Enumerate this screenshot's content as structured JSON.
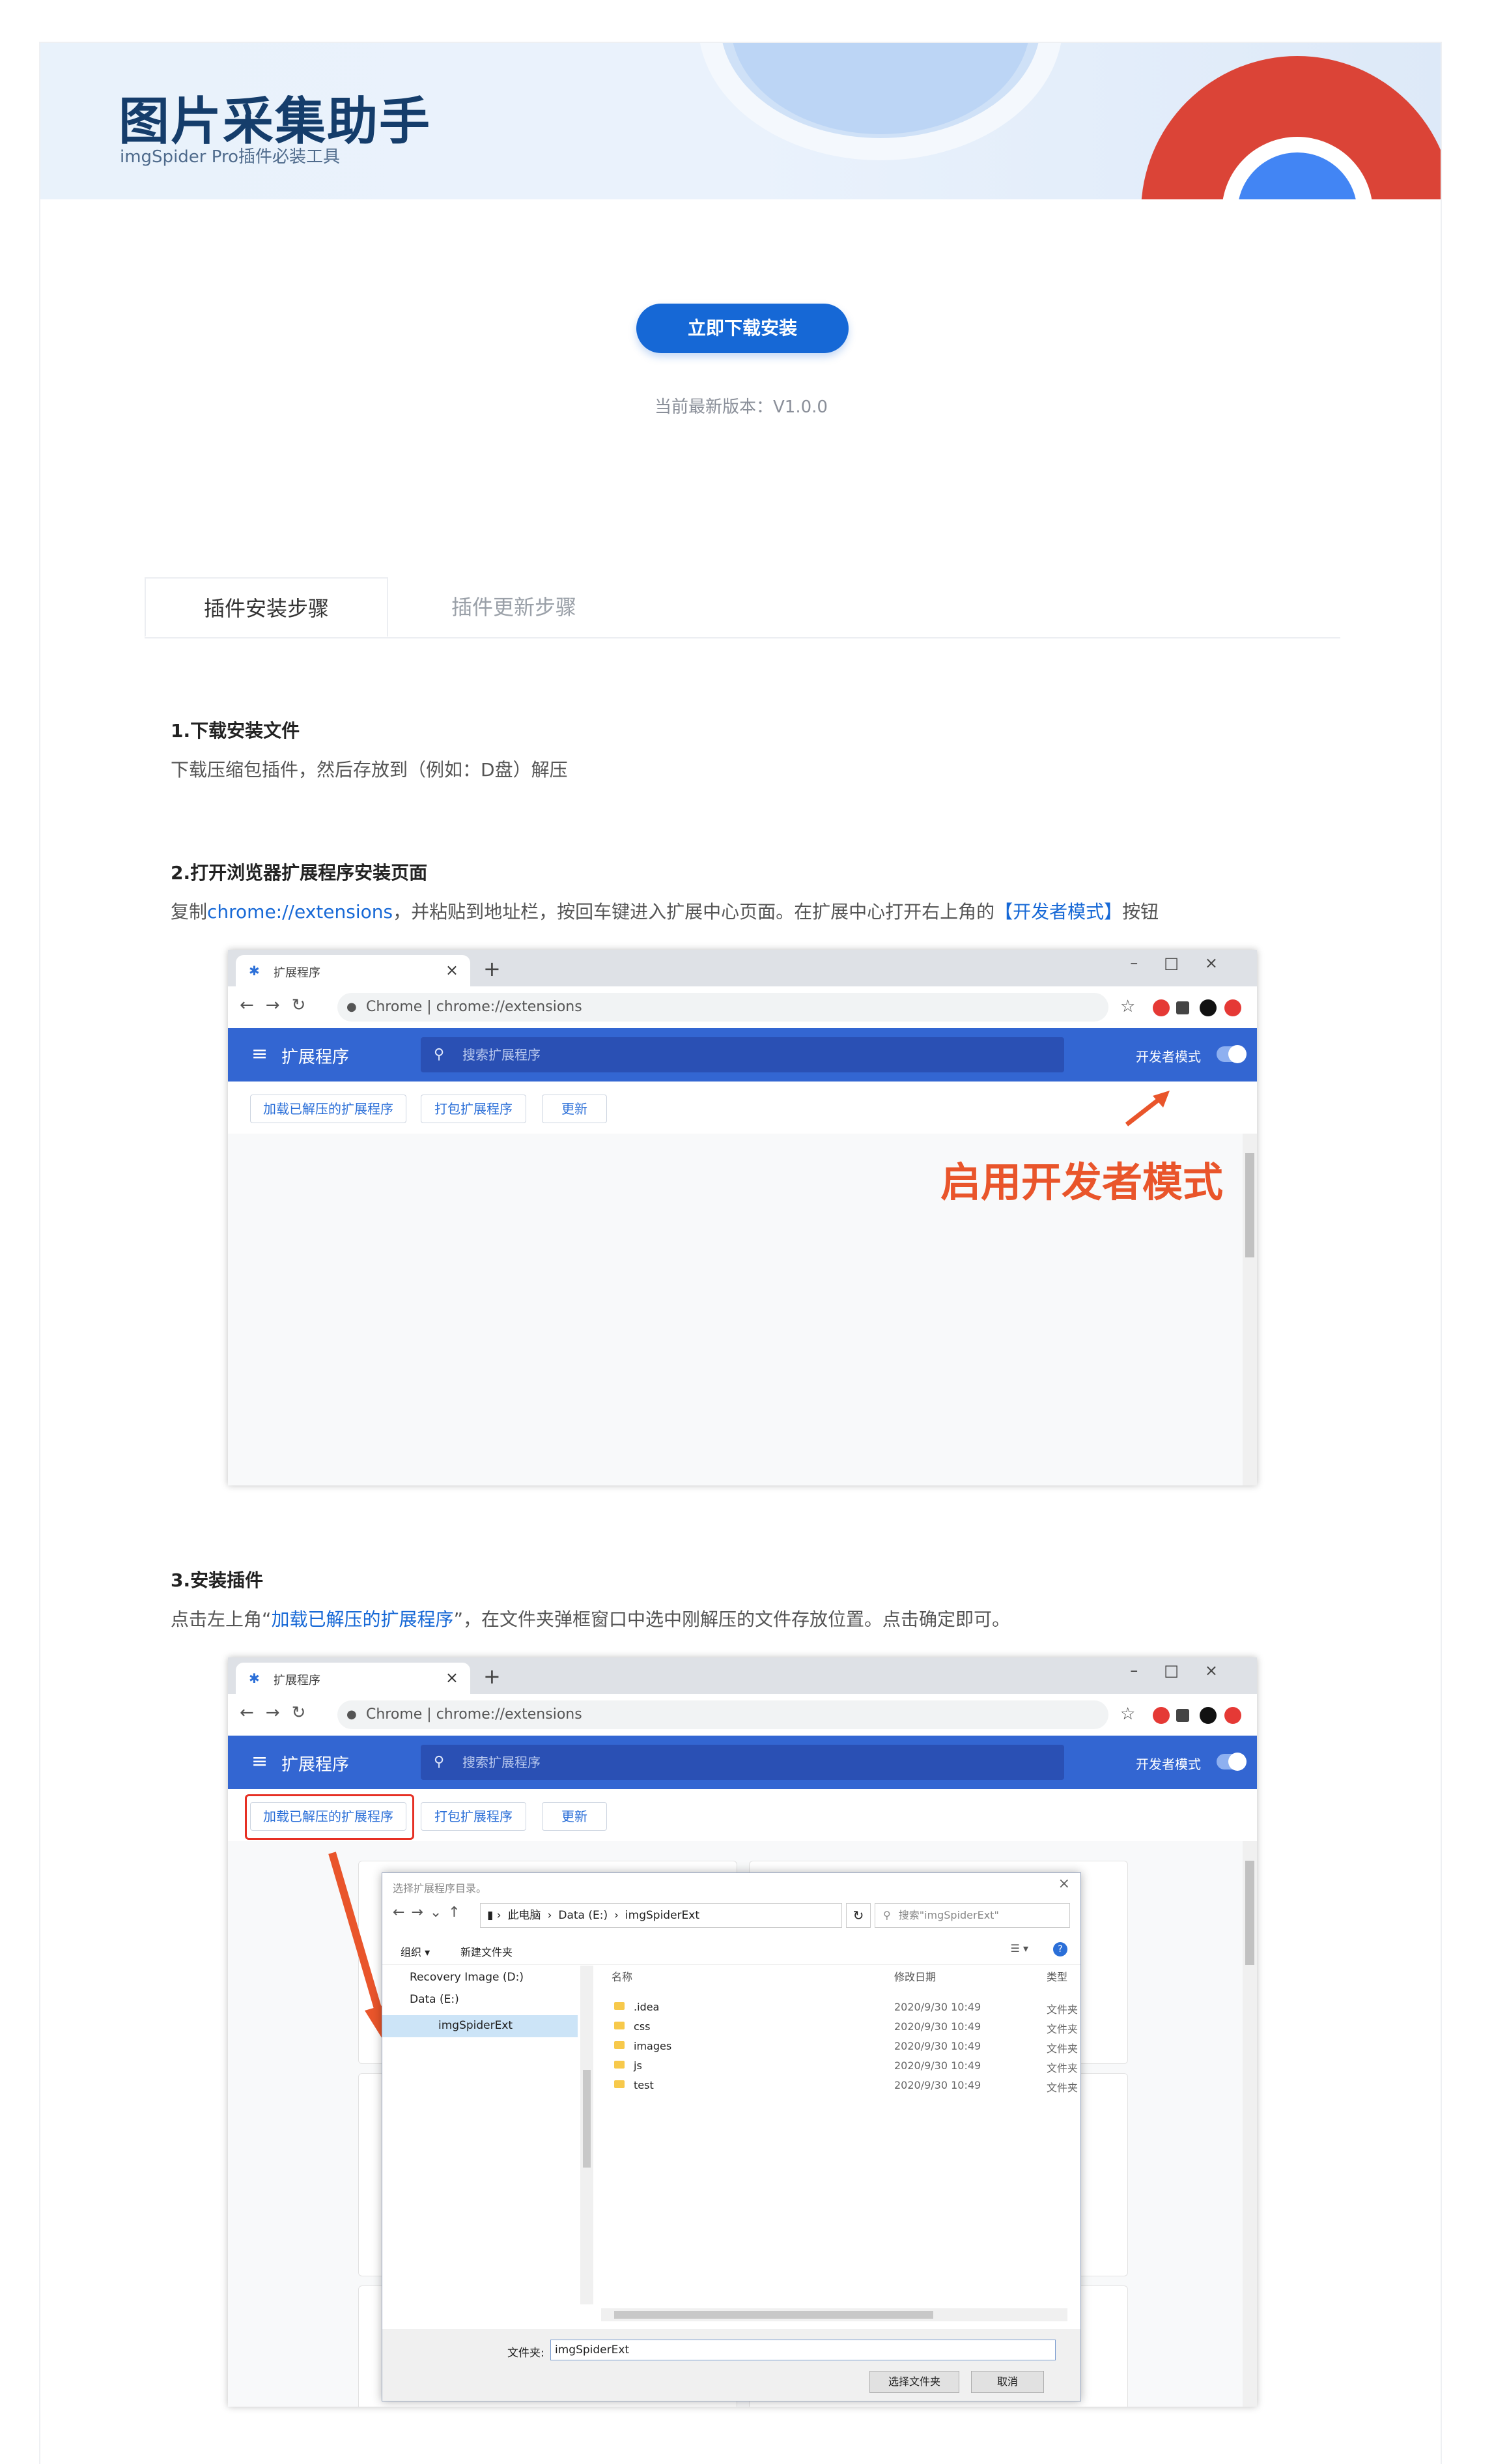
{
  "banner": {
    "title": "图片采集助手",
    "subtitle": "imgSpider Pro插件必装工具"
  },
  "download_button": "立即下载安装",
  "version_text": "当前最新版本：V1.0.0",
  "tabs": [
    {
      "label": "插件安装步骤",
      "active": true
    },
    {
      "label": "插件更新步骤",
      "active": false
    }
  ],
  "steps": [
    {
      "title": "1.下载安装文件",
      "text": "下载压缩包插件，然后存放到（例如：D盘）解压"
    },
    {
      "title": "2.打开浏览器扩展程序安装页面",
      "text_prefix": "复制",
      "text_link": "chrome://extensions",
      "text_mid": "，并粘贴到地址栏，按回车键进入扩展中心页面。在扩展中心打开右上角的",
      "text_link2": "【开发者模式】",
      "text_suffix": "按钮"
    },
    {
      "title": "3.安装插件",
      "text_prefix": "点击左上角“",
      "text_link": "加载已解压的扩展程序",
      "text_suffix": "”，在文件夹弹框窗口中选中刚解压的文件存放位置。点击确定即可。"
    }
  ],
  "browser": {
    "tab_label": "扩展程序",
    "omnibox_label": "Chrome",
    "omnibox_url": "chrome://extensions",
    "header_title": "扩展程序",
    "search_placeholder": "搜索扩展程序",
    "dev_mode_label": "开发者模式",
    "toolbar_buttons": [
      "加载已解压的扩展程序",
      "打包扩展程序",
      "更新"
    ]
  },
  "annotation": "启用开发者模式",
  "dialog": {
    "title": "选择扩展程序目录。",
    "breadcrumb": [
      "此电脑",
      "Data (E:)",
      "imgSpiderExt"
    ],
    "search_placeholder": "搜索\"imgSpiderExt\"",
    "organize": "组织 ▾",
    "new_folder": "新建文件夹",
    "tree": [
      "Recovery Image (D:)",
      "Data (E:)",
      "imgSpiderExt"
    ],
    "columns": [
      "名称",
      "修改日期",
      "类型"
    ],
    "files": [
      {
        "name": ".idea",
        "date": "2020/9/30 10:49",
        "type": "文件夹"
      },
      {
        "name": "css",
        "date": "2020/9/30 10:49",
        "type": "文件夹"
      },
      {
        "name": "images",
        "date": "2020/9/30 10:49",
        "type": "文件夹"
      },
      {
        "name": "js",
        "date": "2020/9/30 10:49",
        "type": "文件夹"
      },
      {
        "name": "test",
        "date": "2020/9/30 10:49",
        "type": "文件夹"
      }
    ],
    "folder_label": "文件夹:",
    "folder_value": "imgSpiderExt",
    "select_button": "选择文件夹",
    "cancel_button": "取消"
  },
  "colors": {
    "accent": "#1668d6",
    "chrome_blue": "#3366d2",
    "annotation_red": "#e9552b"
  }
}
